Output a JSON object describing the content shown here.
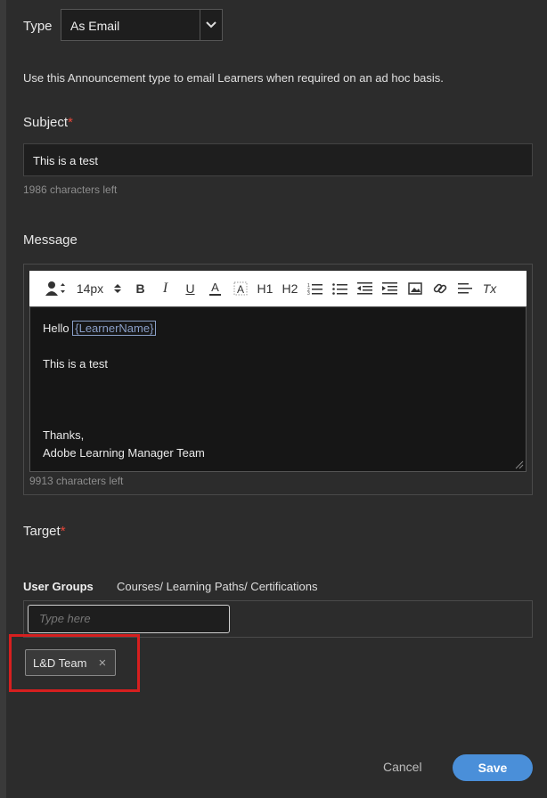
{
  "type_field": {
    "label": "Type",
    "value": "As Email"
  },
  "description": "Use this Announcement type to email Learners when required on an ad hoc basis.",
  "subject": {
    "label": "Subject",
    "required_mark": "*",
    "value": "This is a test",
    "chars_left": "1986 characters left"
  },
  "message": {
    "label": "Message",
    "toolbar": {
      "font_size": "14px",
      "bold": "B",
      "italic": "I",
      "underline": "U",
      "font_color": "A",
      "h1": "H1",
      "h2": "H2",
      "clear_format": "Tx",
      "icons": [
        "insert-variable-icon",
        "highlight-icon",
        "ordered-list-icon",
        "unordered-list-icon",
        "outdent-icon",
        "indent-icon",
        "image-icon",
        "link-icon",
        "align-icon",
        "clear-format-icon"
      ]
    },
    "body": {
      "greeting": "Hello",
      "token": "{LearnerName}",
      "line2": "This is a test",
      "closing": "Thanks,",
      "signature": "Adobe Learning Manager Team"
    },
    "chars_left": "9913 characters left"
  },
  "target": {
    "label": "Target",
    "required_mark": "*",
    "tabs": [
      "User Groups",
      "Courses/ Learning Paths/ Certifications"
    ],
    "input_placeholder": "Type here",
    "chips": [
      "L&D Team"
    ],
    "chip_remove": "×"
  },
  "footer": {
    "cancel": "Cancel",
    "save": "Save"
  },
  "colors": {
    "background": "#2c2c2c",
    "accent": "#4a8fd9",
    "required": "#e8483a",
    "highlight": "#d61f1f"
  }
}
